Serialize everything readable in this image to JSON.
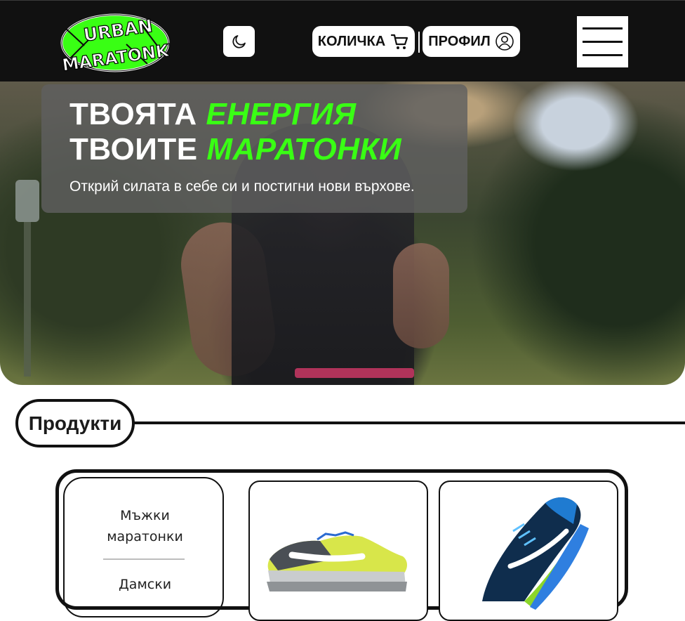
{
  "header": {
    "logo": {
      "line1": "URBAN",
      "line2": "MARATONKI",
      "icon": "urban-maratonki-logo"
    },
    "theme_toggle_icon": "moon-icon",
    "cart_label": "КОЛИЧКА",
    "cart_icon": "cart-icon",
    "profile_label": "ПРОФИЛ",
    "profile_icon": "user-circle-icon",
    "menu_icon": "hamburger-icon"
  },
  "hero": {
    "line1_white": "ТВОЯТА",
    "line1_accent": "ЕНЕРГИЯ",
    "line2_white": "ТВОИТЕ",
    "line2_accent": "МАРАТОНКИ",
    "subtitle": "Открий силата в себе си и постигни нови върхове.",
    "accent_color": "#39ff14"
  },
  "products": {
    "heading": "Продукти",
    "categories": [
      {
        "label": "Мъжки маратонки"
      },
      {
        "label": "Дамски"
      }
    ]
  },
  "colors": {
    "header_bg": "#111111",
    "accent": "#39ff14",
    "border": "#111111"
  }
}
